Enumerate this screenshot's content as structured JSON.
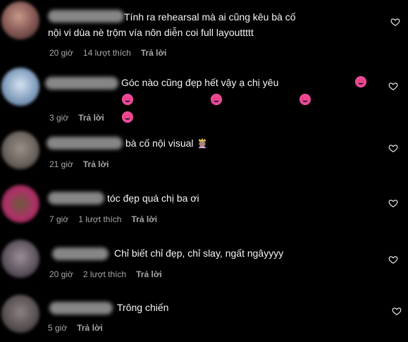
{
  "comments": [
    {
      "text": "Tính ra rehearsal mà ai cũng kêu bà cố nội vi dùa nè trộm vía nôn diễn coi full layouttttt",
      "time": "20 giờ",
      "likes": "14 lượt thích",
      "reply": "Trả lời"
    },
    {
      "text": "Góc nào cũng đẹp hết vậy ạ chị yêu",
      "time": "3 giờ",
      "likes": "",
      "reply": "Trả lời"
    },
    {
      "text": "bà cố nội visual",
      "time": "21 giờ",
      "likes": "",
      "reply": "Trả lời"
    },
    {
      "text": "tóc đẹp quá chị ba ơi",
      "time": "7 giờ",
      "likes": "1 lượt thích",
      "reply": "Trả lời"
    },
    {
      "text": "Chỉ biết chỉ đẹp, chỉ slay, ngất ngâyyyy",
      "time": "20 giờ",
      "likes": "2 lượt thích",
      "reply": "Trả lời"
    },
    {
      "text": "Trông chiến",
      "time": "5 giờ",
      "likes": "",
      "reply": "Trả lời"
    }
  ],
  "icons": {
    "heart": "heart-outline-icon",
    "heart_eyes": "smiling-face-with-heart-eyes-emoji",
    "lady_crown": "woman-with-crown-emoji"
  },
  "colors": {
    "background": "#000000",
    "text": "#f5f5f5",
    "meta": "#a8a8a8"
  }
}
